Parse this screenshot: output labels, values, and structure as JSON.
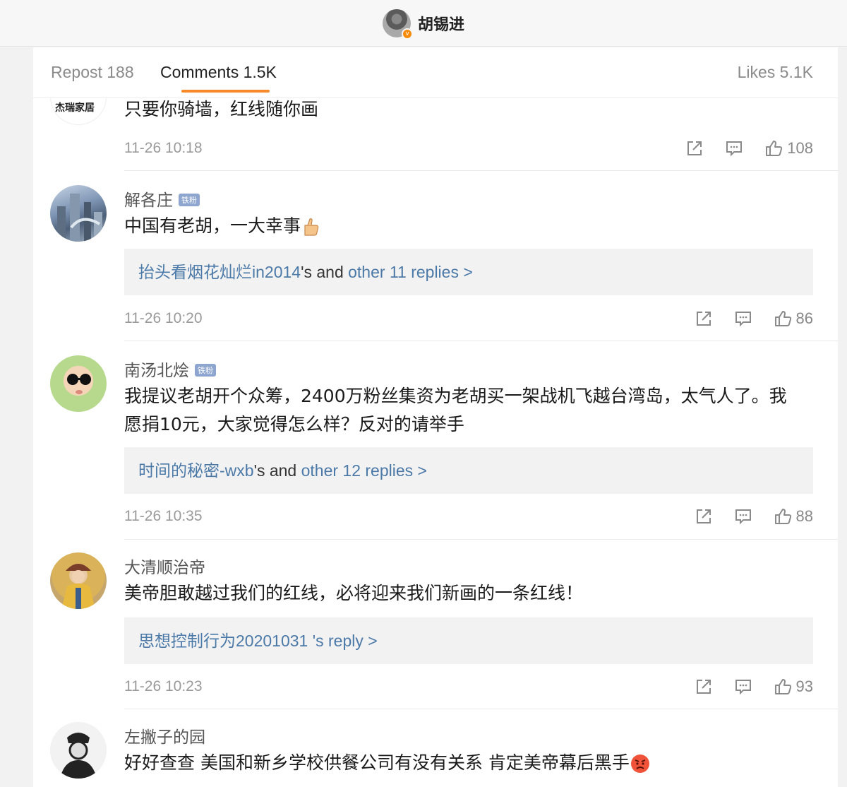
{
  "header": {
    "title": "胡锡进"
  },
  "tabs": {
    "repost": "Repost 188",
    "comments": "Comments 1.5K",
    "likes": "Likes 5.1K"
  },
  "comments": [
    {
      "avatar_text": "杰瑞家居",
      "text": "只要你骑墙，红线随你画",
      "time": "11-26 10:18",
      "likes": "108"
    },
    {
      "name": "解各庄",
      "badge": "铁粉",
      "text": "中国有老胡，一大幸事",
      "reply_user": "抬头看烟花灿烂in2014",
      "reply_mid": "'s and ",
      "reply_more": "other 11 replies >",
      "time": "11-26 10:20",
      "likes": "86"
    },
    {
      "name": "南汤北烩",
      "badge": "铁粉",
      "text": "我提议老胡开个众筹，2400万粉丝集资为老胡买一架战机飞越台湾岛，太气人了。我愿捐10元，大家觉得怎么样？反对的请举手",
      "reply_user": "时间的秘密-wxb",
      "reply_mid": "'s and ",
      "reply_more": "other 12 replies >",
      "time": "11-26 10:35",
      "likes": "88"
    },
    {
      "name": "大清顺治帝",
      "text": "美帝胆敢越过我们的红线，必将迎来我们新画的一条红线！",
      "reply_user": "思想控制行为20201031",
      "reply_more": " 's reply >",
      "time": "11-26 10:23",
      "likes": "93"
    },
    {
      "name": "左撇子的园",
      "text": "好好查查 美国和新乡学校供餐公司有没有关系 肯定美帝幕后黑手"
    }
  ],
  "icons": {
    "share": "share-icon",
    "comment": "comment-icon",
    "like": "thumbs-up-icon"
  },
  "colors": {
    "accent": "#f7892b",
    "link": "#4b79a8",
    "badge": "#8ea6cf"
  }
}
